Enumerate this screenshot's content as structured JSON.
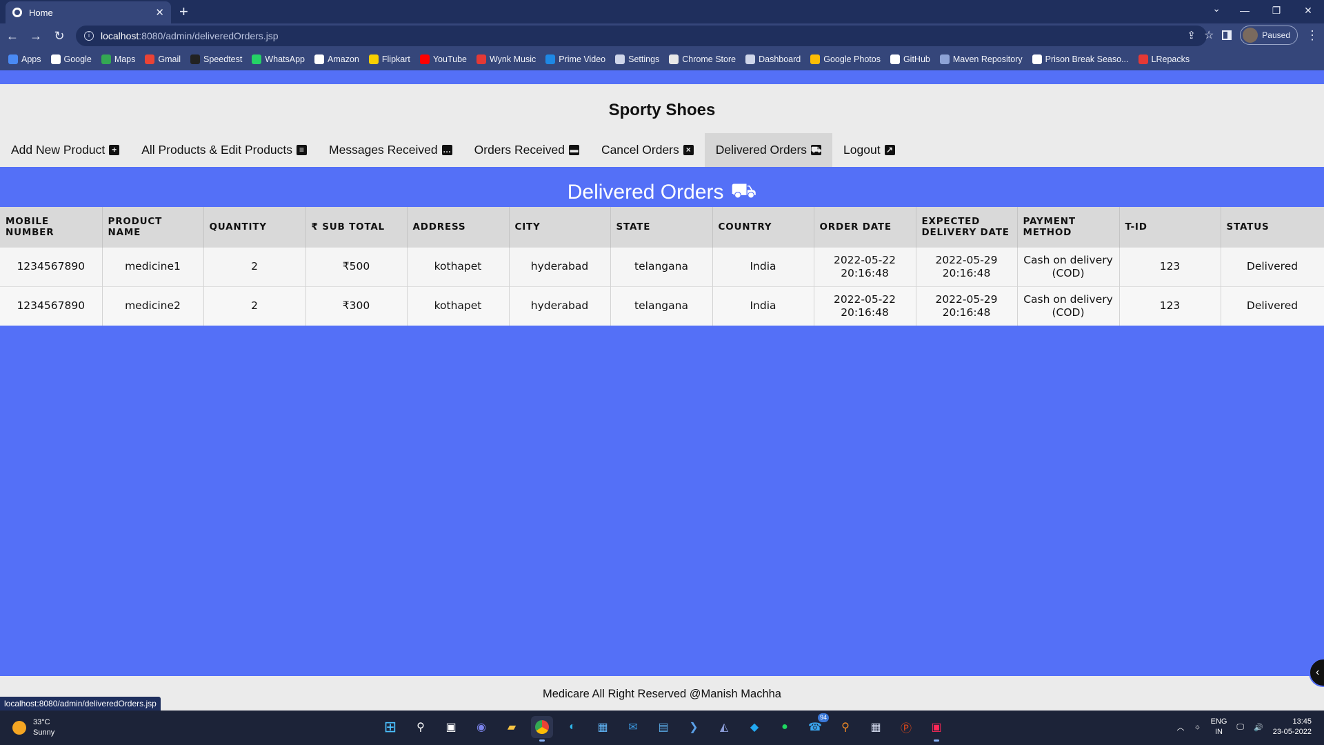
{
  "browser": {
    "tab_title": "Home",
    "url_host": "localhost",
    "url_rest": ":8080/admin/deliveredOrders.jsp",
    "profile_label": "Paused",
    "bookmarks": [
      {
        "label": "Apps",
        "color": "#4a8af4"
      },
      {
        "label": "Google",
        "color": "#ffffff"
      },
      {
        "label": "Maps",
        "color": "#34a853"
      },
      {
        "label": "Gmail",
        "color": "#ea4335"
      },
      {
        "label": "Speedtest",
        "color": "#222222"
      },
      {
        "label": "WhatsApp",
        "color": "#25d366"
      },
      {
        "label": "Amazon",
        "color": "#ffffff"
      },
      {
        "label": "Flipkart",
        "color": "#f8d000"
      },
      {
        "label": "YouTube",
        "color": "#ff0000"
      },
      {
        "label": "Wynk Music",
        "color": "#e53935"
      },
      {
        "label": "Prime Video",
        "color": "#1e88e5"
      },
      {
        "label": "Settings",
        "color": "#cfd6ea"
      },
      {
        "label": "Chrome Store",
        "color": "#e8e8e8"
      },
      {
        "label": "Dashboard",
        "color": "#cfd6ea"
      },
      {
        "label": "Google Photos",
        "color": "#fbbc05"
      },
      {
        "label": "GitHub",
        "color": "#ffffff"
      },
      {
        "label": "Maven Repository",
        "color": "#8ea3d6"
      },
      {
        "label": "Prison Break Seaso...",
        "color": "#ffffff"
      },
      {
        "label": "LRepacks",
        "color": "#e53935"
      }
    ],
    "status_url": "localhost:8080/admin/deliveredOrders.jsp"
  },
  "site": {
    "title": "Sporty Shoes",
    "nav": [
      {
        "label": "Add New Product",
        "icon": "plus-square-icon",
        "glyph": "+"
      },
      {
        "label": "All Products & Edit Products",
        "icon": "list-icon",
        "glyph": "≡"
      },
      {
        "label": "Messages Received",
        "icon": "comment-icon",
        "glyph": "…"
      },
      {
        "label": "Orders Received",
        "icon": "archive-icon",
        "glyph": "▬"
      },
      {
        "label": "Cancel Orders",
        "icon": "close-square-icon",
        "glyph": "×"
      },
      {
        "label": "Delivered Orders",
        "icon": "dolly-icon",
        "glyph": "⛟"
      },
      {
        "label": "Logout",
        "icon": "logout-icon",
        "glyph": "↗"
      }
    ],
    "active_nav": "Delivered Orders",
    "section_title": "Delivered Orders",
    "footer": "Medicare All Right Reserved @Manish Machha"
  },
  "table": {
    "headers": [
      "MOBILE NUMBER",
      "PRODUCT NAME",
      "QUANTITY",
      "₹ SUB TOTAL",
      "ADDRESS",
      "CITY",
      "STATE",
      "COUNTRY",
      "ORDER DATE",
      "EXPECTED DELIVERY DATE",
      "PAYMENT METHOD",
      "T-ID",
      "STATUS"
    ],
    "rows": [
      [
        "1234567890",
        "medicine1",
        "2",
        "₹500",
        "kothapet",
        "hyderabad",
        "telangana",
        "India",
        "2022-05-22 20:16:48",
        "2022-05-29 20:16:48",
        "Cash on delivery (COD)",
        "123",
        "Delivered"
      ],
      [
        "1234567890",
        "medicine2",
        "2",
        "₹300",
        "kothapet",
        "hyderabad",
        "telangana",
        "India",
        "2022-05-22 20:16:48",
        "2022-05-29 20:16:48",
        "Cash on delivery (COD)",
        "123",
        "Delivered"
      ]
    ]
  },
  "taskbar": {
    "temperature": "33°C",
    "weather": "Sunny",
    "lang_top": "ENG",
    "lang_bottom": "IN",
    "time": "13:45",
    "date": "23-05-2022",
    "badge_count": "94"
  },
  "colors": {
    "page_bg": "#5470f7",
    "header_bg": "#ebebeb",
    "browser_frame": "#35467a"
  }
}
